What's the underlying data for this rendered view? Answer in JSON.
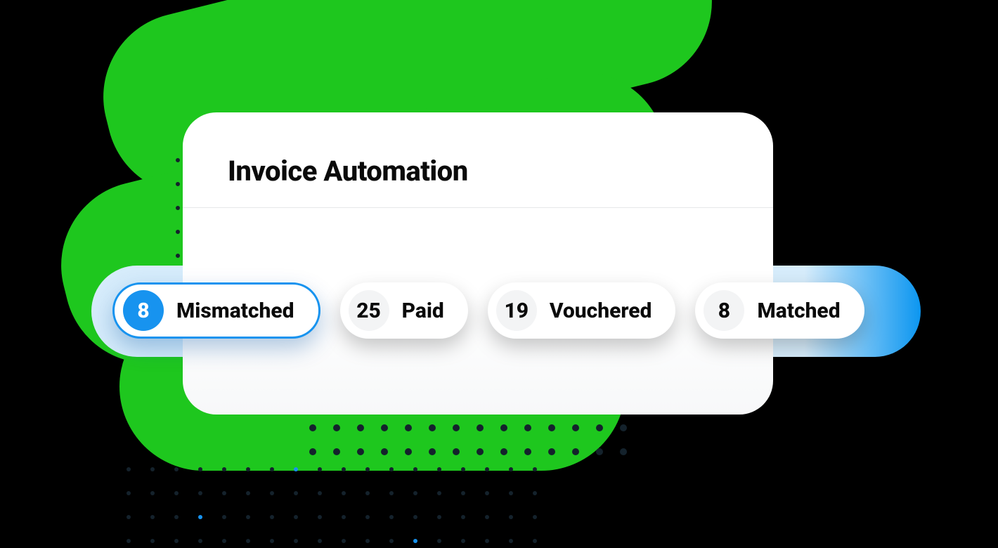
{
  "card": {
    "title": "Invoice Automation"
  },
  "filters": [
    {
      "count": "8",
      "label": "Mismatched",
      "selected": true
    },
    {
      "count": "25",
      "label": "Paid",
      "selected": false
    },
    {
      "count": "19",
      "label": "Vouchered",
      "selected": false
    },
    {
      "count": "8",
      "label": "Matched",
      "selected": false
    }
  ]
}
